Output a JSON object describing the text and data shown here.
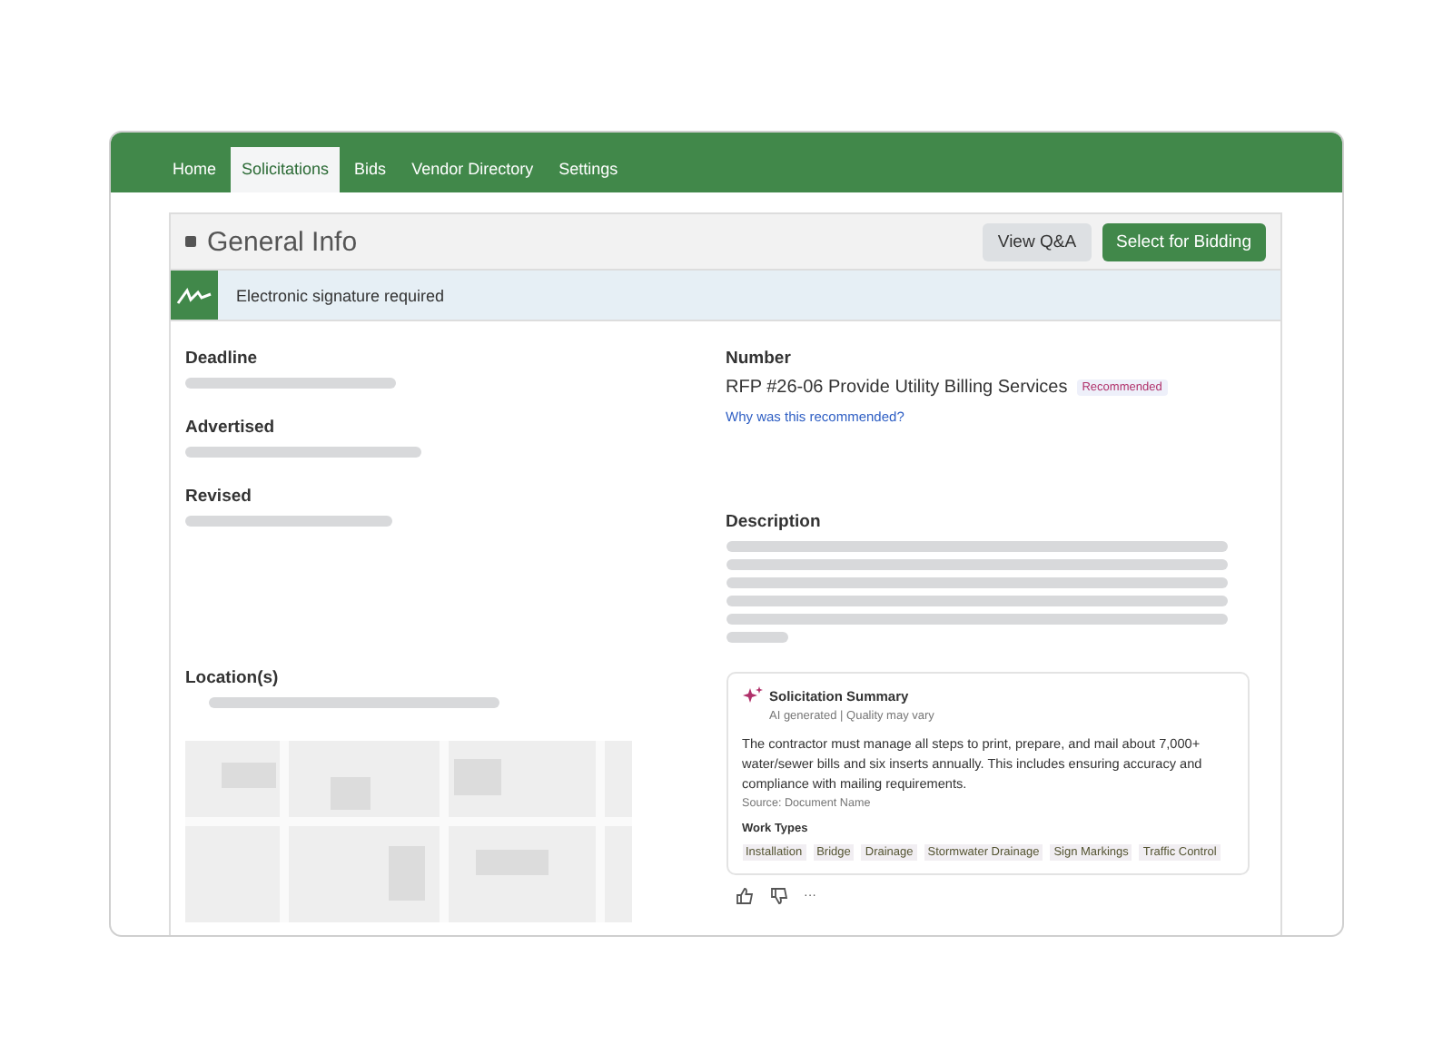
{
  "nav": {
    "tabs": [
      {
        "label": "Home",
        "selected": false
      },
      {
        "label": "Solicitations",
        "selected": true
      },
      {
        "label": "Bids",
        "selected": false
      },
      {
        "label": "Vendor Directory",
        "selected": false
      },
      {
        "label": "Settings",
        "selected": false
      }
    ]
  },
  "panel": {
    "title": "General Info",
    "buttons": [
      {
        "label": "View Q&A",
        "kind": "secondary"
      },
      {
        "label": "Select for Bidding",
        "kind": "primary"
      }
    ]
  },
  "notice": {
    "text": "Electronic signature required"
  },
  "left_fields": [
    {
      "label": "Deadline"
    },
    {
      "label": "Advertised"
    },
    {
      "label": "Revised"
    }
  ],
  "number": {
    "label": "Number",
    "value": "RFP #26-06 Provide Utility Billing Services",
    "badge": "Recommended",
    "link": "Why was this recommended?"
  },
  "description": {
    "label": "Description"
  },
  "location": {
    "label": "Location(s)"
  },
  "summary": {
    "title": "Solicitation Summary",
    "subtitle": "AI generated | Quality may vary",
    "body": "The contractor must manage all steps to print, prepare, and mail about 7,000+ water/sewer bills and six inserts annually. This includes ensuring accuracy and compliance with mailing requirements.",
    "source": "Source: Document Name",
    "work_types_label": "Work Types",
    "work_types": [
      "Installation",
      "Bridge",
      "Drainage",
      "Stormwater Drainage",
      "Sign Markings",
      "Traffic Control"
    ]
  },
  "feedback": {
    "more": "···"
  }
}
